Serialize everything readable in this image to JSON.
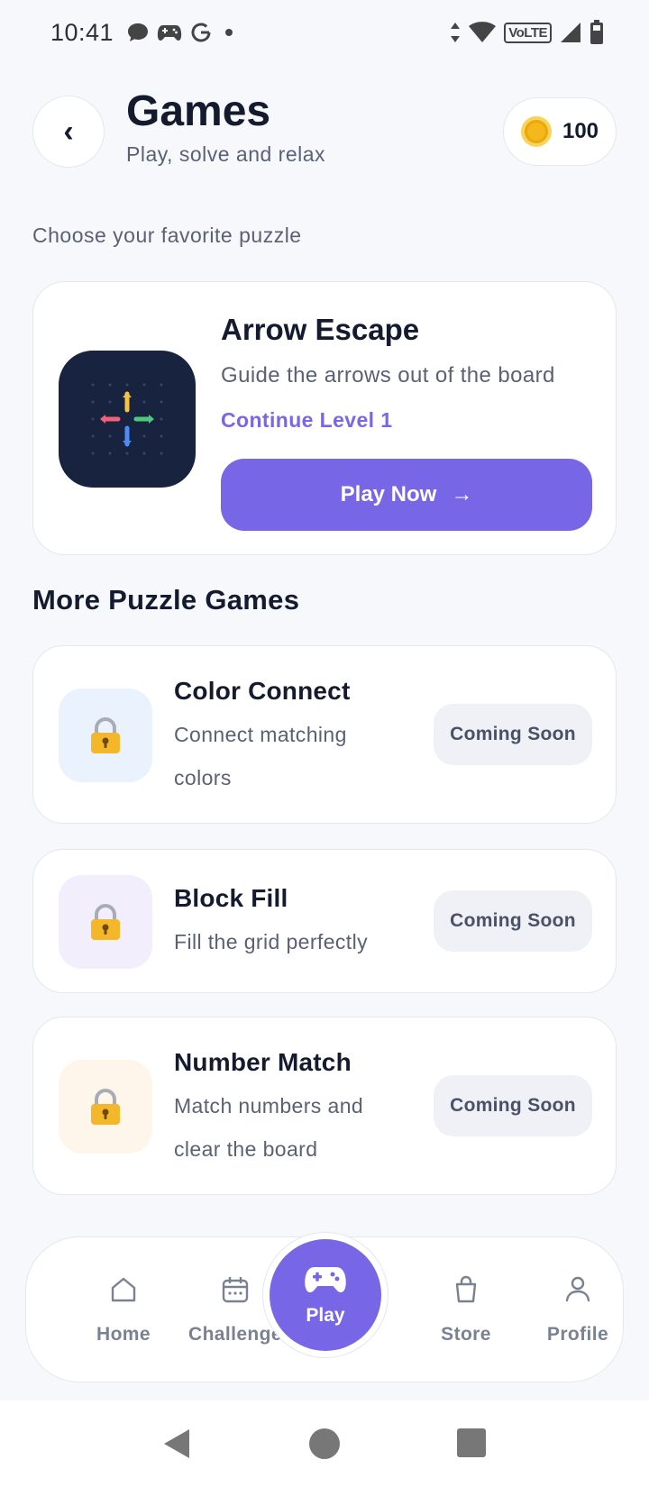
{
  "status_bar": {
    "time": "10:41",
    "network": "VoLTE"
  },
  "header": {
    "title": "Games",
    "subtitle": "Play, solve and relax",
    "back_icon": "‹",
    "coins": "100"
  },
  "section_intro": "Choose your favorite puzzle",
  "featured": {
    "title": "Arrow Escape",
    "description": "Guide the arrows out of the board",
    "progress": "Continue Level 1",
    "button_label": "Play Now",
    "button_arrow": "→"
  },
  "more_title": "More Puzzle Games",
  "games": [
    {
      "title": "Color Connect",
      "description": "Connect matching colors",
      "status": "Coming Soon",
      "thumb_color": "#eaf3fd"
    },
    {
      "title": "Block Fill",
      "description": "Fill the grid perfectly",
      "status": "Coming Soon",
      "thumb_color": "#f2eefc"
    },
    {
      "title": "Number Match",
      "description": "Match numbers and clear the board",
      "status": "Coming Soon",
      "thumb_color": "#fef6ea"
    }
  ],
  "nav": {
    "home": "Home",
    "challenge": "Challenge",
    "play": "Play",
    "store": "Store",
    "profile": "Profile"
  },
  "colors": {
    "accent": "#7766e6",
    "coin": "#f4b71c",
    "thumb_dark": "#18233f"
  }
}
